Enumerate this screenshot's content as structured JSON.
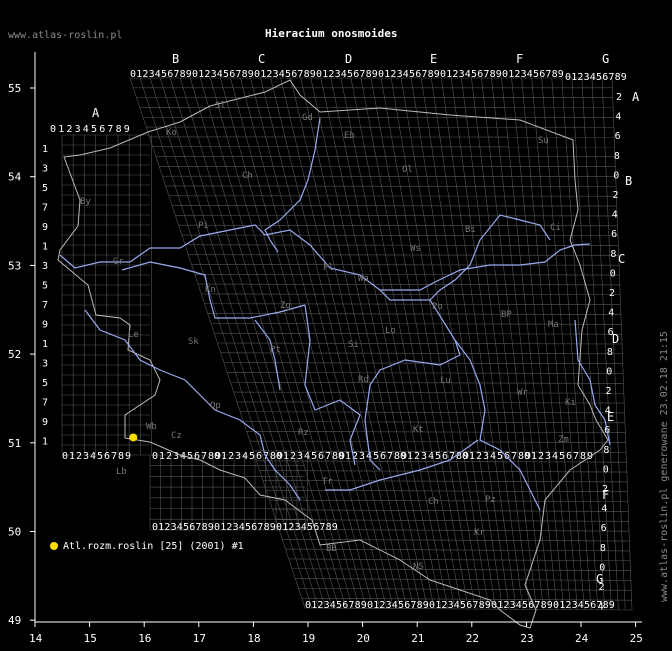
{
  "header": {
    "site": "www.atlas-roslin.pl",
    "title": "Hieracium onosmoides",
    "generated": "www.atlas-roslin.pl generowane 23.02.18 21:15"
  },
  "axes": {
    "x_ticks": [
      "14",
      "15",
      "16",
      "17",
      "18",
      "19",
      "20",
      "21",
      "22",
      "23",
      "24",
      "25"
    ],
    "y_ticks": [
      "55",
      "54",
      "53",
      "52",
      "51",
      "50",
      "49"
    ]
  },
  "grid": {
    "zone_letters_top": [
      "A",
      "B",
      "C",
      "D",
      "E",
      "F",
      "G"
    ],
    "zone_letters_right": [
      "A",
      "B",
      "C",
      "D",
      "E",
      "F",
      "G"
    ],
    "digit_row": "0123456789",
    "digit_column": [
      "1",
      "3",
      "5",
      "7",
      "9"
    ]
  },
  "regions": [
    "Sl",
    "Ko",
    "Gd",
    "Eb",
    "Ol",
    "Su",
    "Ch",
    "Pi",
    "By",
    "Gr",
    "Bi",
    "Ci",
    "Ws",
    "Pl",
    "Wa",
    "Po",
    "Kn",
    "Zg",
    "Le",
    "Sk",
    "Lo",
    "Si",
    "BP",
    "Ma",
    "Pt",
    "Rd",
    "Lu",
    "Lb",
    "Wr",
    "Op",
    "Wb",
    "Cz",
    "Ki",
    "Kt",
    "Tr",
    "Ch",
    "Zm",
    "Pz",
    "Kr",
    "BB",
    "NS",
    "Rz"
  ],
  "legend": {
    "marker_color": "#ffdd00",
    "label": "Atl.rozm.roslin [25] (2001) #1"
  },
  "records": [
    {
      "lon": 15.8,
      "lat": 51.06,
      "color": "#ffdd00"
    }
  ]
}
